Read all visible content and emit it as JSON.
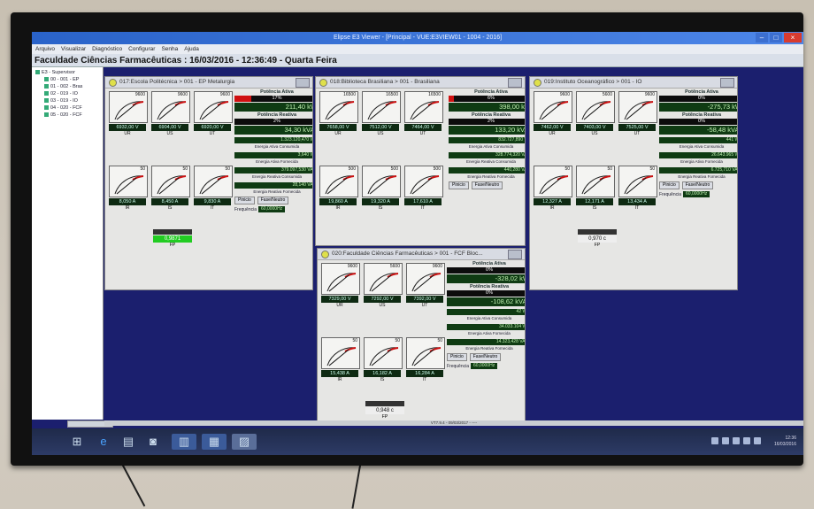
{
  "window": {
    "title": "Elipse E3 Viewer - [Principal - VUE:E3VIEW01 - 1004 - 2016]"
  },
  "menu": [
    "Arquivo",
    "Visualizar",
    "Diagnóstico",
    "Configurar",
    "Senha",
    "Ajuda"
  ],
  "header": {
    "text": "Faculdade Ciências Farmacêuticas : 16/03/2016 - 12:36:49 - Quarta Feira"
  },
  "tree": {
    "items": [
      "E3 - Supervisor",
      "00 - 001 - EP",
      "01 - 002 - Bras",
      "02 - 019 - IO",
      "03 - 019 - IO",
      "04 - 020 - FCF",
      "05 - 020 - FCF"
    ]
  },
  "panels": [
    {
      "title": "017:Escola Politécnica > 001 - EP Metalurgia",
      "v": [
        {
          "max": "9600",
          "value": "6932,00 V",
          "label": "UR"
        },
        {
          "max": "9600",
          "value": "6904,00 V",
          "label": "US"
        },
        {
          "max": "9600",
          "value": "6920,00 V",
          "label": "UT"
        }
      ],
      "i": [
        {
          "max": "50",
          "value": "8,050 A",
          "label": "IR"
        },
        {
          "max": "50",
          "value": "8,450 A",
          "label": "IS"
        },
        {
          "max": "50",
          "value": "9,830 A",
          "label": "IT"
        }
      ],
      "pa_title": "Potência Ativa",
      "pa_pct": "17%",
      "pa_val": "211,40 kW",
      "pr_title": "Potência Reativa",
      "pr_pct": "2%",
      "pr_val": "34,30 kVAr",
      "e1": "1.323.120,470 Wh",
      "e1c": "Energia Ativa Consumida",
      "e2": "3,640 Wh",
      "e2c": "Energia Ativa Fornecida",
      "e3": "379.097,530 VArh",
      "e3c": "Energia Reativa Consumida",
      "e4": "28,140 VArh",
      "e4c": "Energia Reativa Fornecida",
      "fp": "0,9871",
      "fpl": "FP",
      "btn1": "Pinicio",
      "btn2": "Fase/Neutro",
      "freq_l": "Frequência",
      "freq": "60,0000Hz"
    },
    {
      "title": "018:Biblioteca Brasiliana > 001 - Brasiliana",
      "v": [
        {
          "max": "16500",
          "value": "7658,00 V",
          "label": "UR"
        },
        {
          "max": "16500",
          "value": "7512,00 V",
          "label": "US"
        },
        {
          "max": "16500",
          "value": "7464,00 V",
          "label": "UT"
        }
      ],
      "i": [
        {
          "max": "500",
          "value": "19,860 A",
          "label": "IR"
        },
        {
          "max": "500",
          "value": "19,320 A",
          "label": "IS"
        },
        {
          "max": "500",
          "value": "17,610 A",
          "label": "IT"
        }
      ],
      "pa_title": "Potência Ativa",
      "pa_pct": "6%",
      "pa_val": "398,00 kW",
      "pr_title": "Potência Reativa",
      "pr_pct": "2%",
      "pr_val": "133,20 kVAr",
      "e1": "832.727,890 Wh",
      "e1c": "Energia Ativa Consumida",
      "e3": "328.774,320 VArh",
      "e3c": "Energia Reativa Consumida",
      "e4": "440,280 VArh",
      "e4c": "Energia Reativa Fornecida",
      "btn1": "Pinicio",
      "btn2": "Fase/Neutro"
    },
    {
      "title": "019:Instituto Oceanográfico > 001 - IO",
      "v": [
        {
          "max": "9600",
          "value": "7462,00 V",
          "label": "UR"
        },
        {
          "max": "5600",
          "value": "7403,00 V",
          "label": "US"
        },
        {
          "max": "9600",
          "value": "7525,00 V",
          "label": "UT"
        }
      ],
      "i": [
        {
          "max": "50",
          "value": "12,327 A",
          "label": "IR"
        },
        {
          "max": "50",
          "value": "12,171 A",
          "label": "IS"
        },
        {
          "max": "50",
          "value": "13,434 A",
          "label": "IT"
        }
      ],
      "pa_title": "Potência Ativa",
      "pa_pct": "0%",
      "pa_val": "-275,73 kW",
      "pr_title": "Potência Reativa",
      "pr_pct": "0%",
      "pr_val": "-58,48 kVAr",
      "e1": "441 Wh",
      "e1c": "Energia Ativa Consumida",
      "e2": "26.643.965 Wh",
      "e2c": "Energia Ativa Fornecida",
      "e4": "6.725,710 VArh",
      "e4c": "Energia Reativa Fornecida",
      "fp": "0,970 c",
      "fpl": "FP",
      "btn1": "Pinicio",
      "btn2": "Fase/Neutro",
      "freq_l": "Frequência",
      "freq": "60,0000Hz"
    },
    {
      "title": "020:Faculdade Ciências Farmacêuticas > 001 - FCF Bloc...",
      "v": [
        {
          "max": "9600",
          "value": "7329,00 V",
          "label": "UR"
        },
        {
          "max": "5600",
          "value": "7292,00 V",
          "label": "US"
        },
        {
          "max": "9600",
          "value": "7392,00 V",
          "label": "UT"
        }
      ],
      "i": [
        {
          "max": "50",
          "value": "15,438 A",
          "label": "IR"
        },
        {
          "max": "50",
          "value": "16,182 A",
          "label": "IS"
        },
        {
          "max": "50",
          "value": "16,284 A",
          "label": "IT"
        }
      ],
      "pa_title": "Potência Ativa",
      "pa_pct": "0%",
      "pa_val": "-328,02 kW",
      "pr_title": "Potência Reativa",
      "pr_pct": "0%",
      "pr_val": "-108,62 kVAr",
      "e1": "42 Wh",
      "e1c": "Energia Ativa Consumida",
      "e2": "34.033.104 Wh",
      "e2c": "Energia Ativa Fornecida",
      "e4": "14.323,428 VArh",
      "e4c": "Energia Reativa Fornecida",
      "fp": "0,948 c",
      "fpl": "FP",
      "btn1": "Pinicio",
      "btn2": "Fase/Neutro",
      "freq_l": "Frequência",
      "freq": "60,0000Hz"
    }
  ],
  "status": {
    "text": "VT7.9.4 - 09/03/2017 - ----"
  },
  "clock": {
    "time": "12:36",
    "date": "16/03/2016"
  },
  "colors": {
    "screen_bg": "#1b1f6e",
    "value_bg": "#0f3b13",
    "fp_ok": "#22cc22",
    "alarm": "#d01010"
  }
}
